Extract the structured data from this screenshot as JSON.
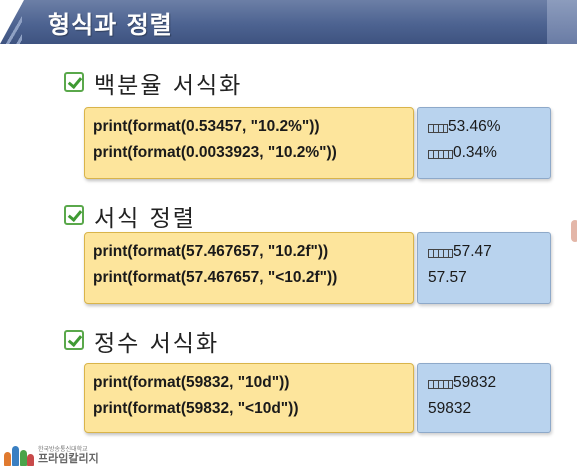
{
  "header": {
    "title": "형식과 정렬"
  },
  "sections": [
    {
      "title": "백분율 서식화",
      "code": [
        "print(format(0.53457, \"10.2%\"))",
        "print(format(0.0033923, \"10.2%\"))"
      ],
      "output": [
        {
          "pad": 4,
          "text": "53.46%"
        },
        {
          "pad": 5,
          "text": "0.34%"
        }
      ]
    },
    {
      "title": "서식 정렬",
      "code": [
        "print(format(57.467657, \"10.2f\"))",
        "print(format(57.467657, \"<10.2f\"))"
      ],
      "output": [
        {
          "pad": 5,
          "text": "57.47"
        },
        {
          "pad": 0,
          "text": "57.57"
        }
      ]
    },
    {
      "title": "정수 서식화",
      "code": [
        "print(format(59832, \"10d\"))",
        "print(format(59832, \"<10d\"))"
      ],
      "output": [
        {
          "pad": 5,
          "text": "59832"
        },
        {
          "pad": 0,
          "text": "59832"
        }
      ]
    }
  ],
  "footer": {
    "line1": "한국방송통신대학교",
    "line2": "프라임칼리지"
  }
}
